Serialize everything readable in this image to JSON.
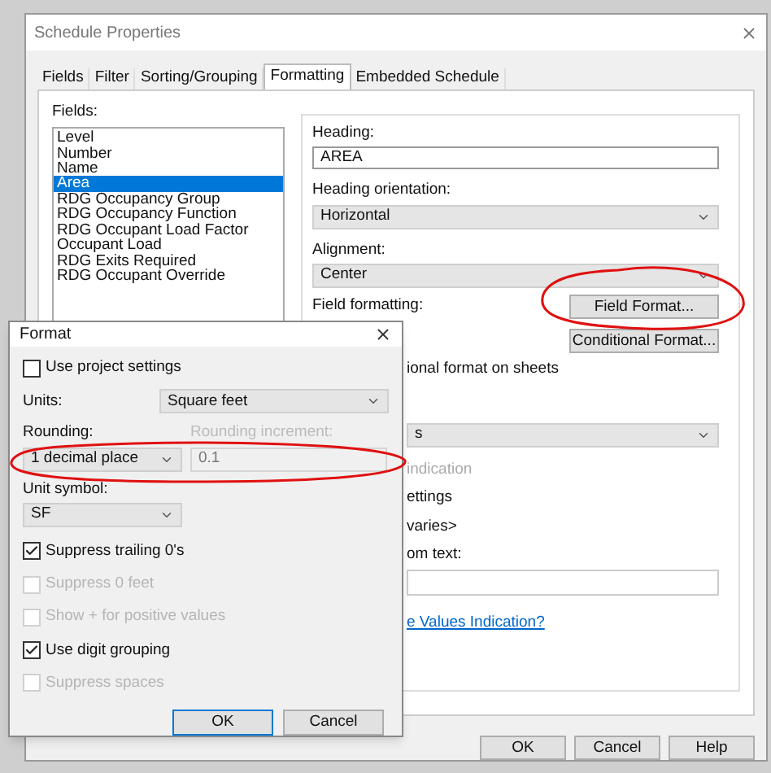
{
  "window": {
    "title": "Schedule Properties"
  },
  "tabs": [
    {
      "label": "Fields",
      "selected": false
    },
    {
      "label": "Filter",
      "selected": false
    },
    {
      "label": "Sorting/Grouping",
      "selected": false
    },
    {
      "label": "Formatting",
      "selected": true
    },
    {
      "label": "Embedded Schedule",
      "selected": false
    }
  ],
  "fields": {
    "label": "Fields:",
    "items": [
      {
        "label": "Level",
        "selected": false
      },
      {
        "label": "Number",
        "selected": false
      },
      {
        "label": "Name",
        "selected": false
      },
      {
        "label": "Area",
        "selected": true
      },
      {
        "label": "RDG Occupancy Group",
        "selected": false
      },
      {
        "label": "RDG Occupancy Function",
        "selected": false
      },
      {
        "label": "RDG Occupant Load Factor",
        "selected": false
      },
      {
        "label": "Occupant Load",
        "selected": false
      },
      {
        "label": "RDG Exits Required",
        "selected": false
      },
      {
        "label": "RDG Occupant Override",
        "selected": false
      }
    ]
  },
  "heading": {
    "label": "Heading:",
    "value": "AREA"
  },
  "heading_orientation": {
    "label": "Heading orientation:",
    "value": "Horizontal"
  },
  "alignment": {
    "label": "Alignment:",
    "value": "Center"
  },
  "field_formatting": {
    "label": "Field formatting:",
    "buttons": [
      "Field Format...",
      "Conditional Format..."
    ]
  },
  "partly_hidden": [
    {
      "kind": "text",
      "text": "ional format on sheets",
      "disabled": false
    },
    {
      "kind": "select",
      "value": "s"
    },
    {
      "kind": "text",
      "text": "indication",
      "disabled": true
    },
    {
      "kind": "text",
      "text": "ettings",
      "disabled": false
    },
    {
      "kind": "text",
      "text": "varies>",
      "disabled": false
    },
    {
      "kind": "text",
      "text": "om text:",
      "disabled": false
    },
    {
      "kind": "input"
    },
    {
      "kind": "link",
      "text": "e Values Indication?"
    }
  ],
  "buttons": [
    "OK",
    "Cancel",
    "Help"
  ],
  "format_dialog": {
    "title": "Format",
    "use_project_settings": {
      "label": "Use project settings",
      "checked": false
    },
    "units": {
      "label": "Units:",
      "value": "Square feet"
    },
    "rounding": {
      "label": "Rounding:",
      "value": "1 decimal place"
    },
    "rounding_increment": {
      "label": "Rounding increment:",
      "value": "0.1",
      "disabled": true
    },
    "unit_symbol": {
      "label": "Unit symbol:",
      "value": "SF"
    },
    "options": [
      {
        "label": "Suppress trailing 0's",
        "checked": true,
        "disabled": false
      },
      {
        "label": "Suppress 0 feet",
        "checked": false,
        "disabled": true
      },
      {
        "label": "Show + for positive values",
        "checked": false,
        "disabled": true
      },
      {
        "label": "Use digit grouping",
        "checked": true,
        "disabled": false
      },
      {
        "label": "Suppress spaces",
        "checked": false,
        "disabled": true
      }
    ],
    "buttons": [
      {
        "label": "OK",
        "default": true
      },
      {
        "label": "Cancel",
        "default": false
      }
    ]
  }
}
